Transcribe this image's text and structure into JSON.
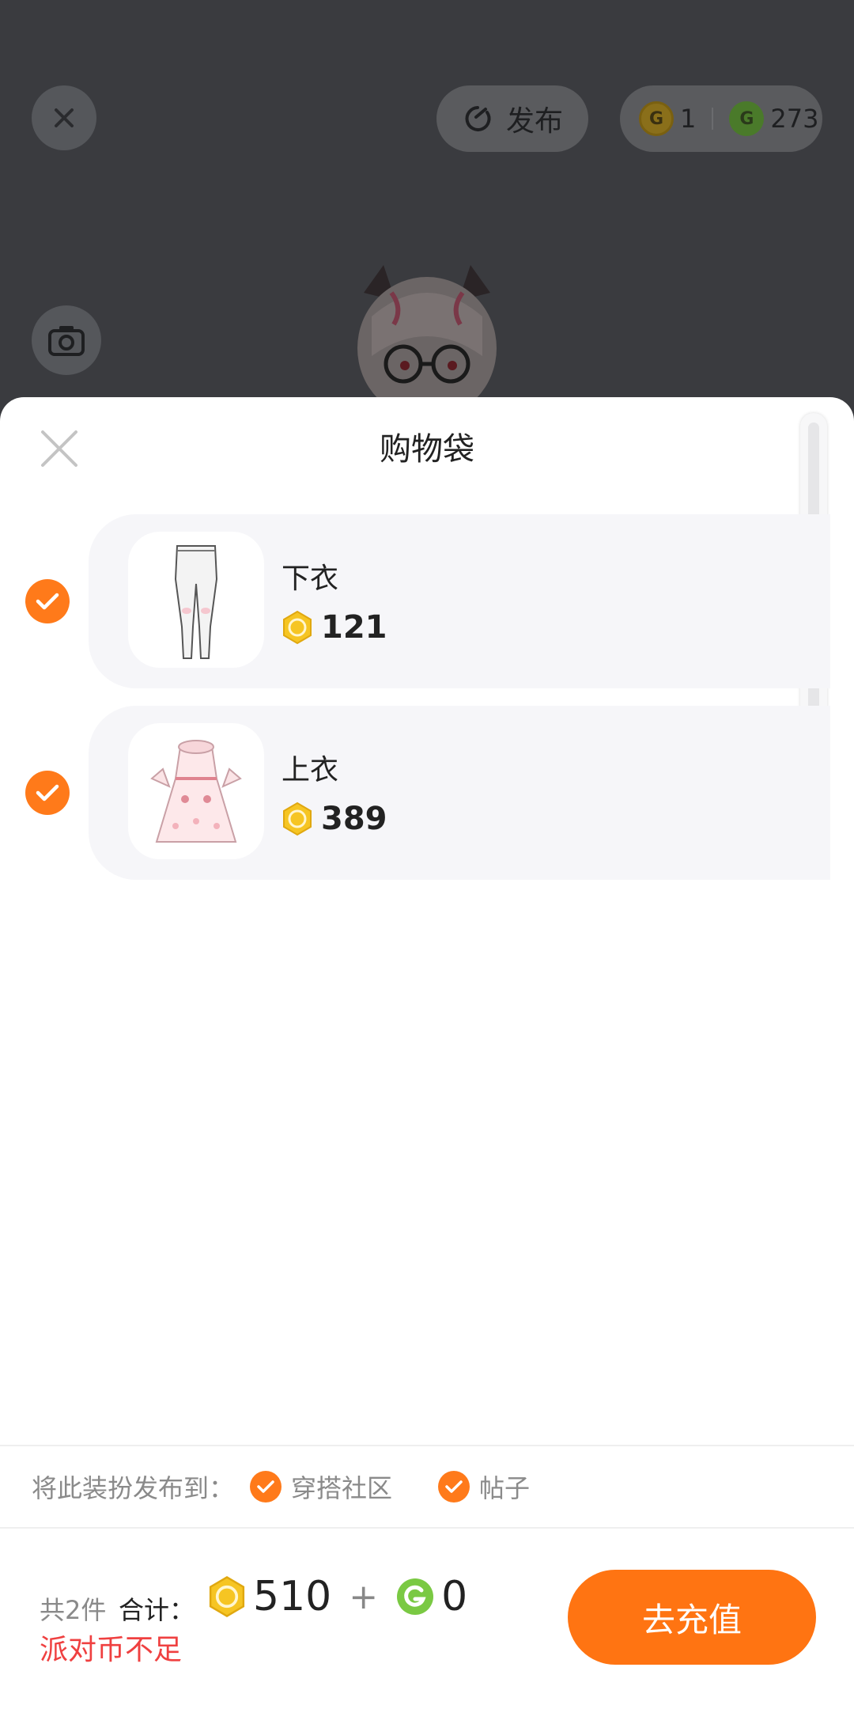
{
  "header": {
    "publish_label": "发布",
    "coin_gold_count": "1",
    "coin_green_count": "273"
  },
  "sheet": {
    "title": "购物袋",
    "items": [
      {
        "name": "下衣",
        "price": "121",
        "checked": true
      },
      {
        "name": "上衣",
        "price": "389",
        "checked": true
      }
    ]
  },
  "publish": {
    "label": "将此装扮发布到：",
    "options": [
      {
        "label": "穿搭社区",
        "checked": true
      },
      {
        "label": "帖子",
        "checked": true
      }
    ]
  },
  "footer": {
    "count_label": "共2件",
    "total_label": "合计：",
    "gold_total": "510",
    "plus": "+",
    "green_total": "0",
    "warning": "派对币不足",
    "recharge_label": "去充值"
  },
  "colors": {
    "accent": "#ff7412",
    "warning": "#ef4040",
    "gold_coin": "#f2b81d",
    "green_coin": "#7ac943",
    "scroll_thumb": "#1a63ff"
  },
  "icons": {
    "close": "close-icon",
    "publish": "refresh-arrow-icon",
    "camera": "camera-icon",
    "gold_coin": "gold-coin-icon",
    "green_coin": "green-coin-icon",
    "check": "check-icon"
  }
}
